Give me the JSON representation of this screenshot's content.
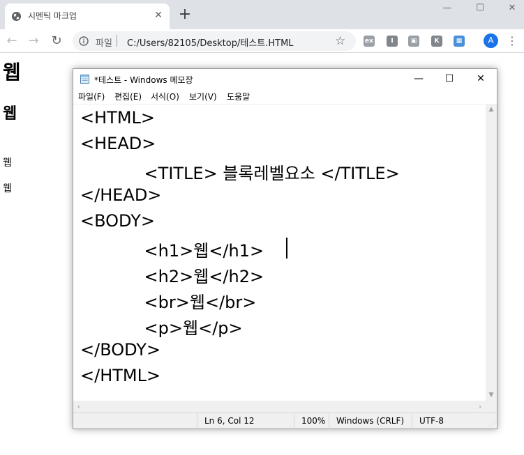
{
  "browser": {
    "tab_title": "시멘틱 마크업",
    "tab_close": "✕",
    "new_tab": "+",
    "window_controls": {
      "minimize": "—",
      "maximize": "☐",
      "close": "✕"
    },
    "nav": {
      "back": "←",
      "forward": "→",
      "reload": "↻"
    },
    "address": {
      "scheme_label": "파일",
      "url": "C:/Users/82105/Desktop/테스트.HTML"
    },
    "extensions": [
      {
        "name": "ext-gray-icon",
        "glyph": "ex",
        "color": "#9aa0a6"
      },
      {
        "name": "ext-i-icon",
        "glyph": "I",
        "color": "#80868b"
      },
      {
        "name": "ext-screen-icon",
        "glyph": "▣",
        "color": "#9aa0a6"
      },
      {
        "name": "ext-k-icon",
        "glyph": "K",
        "color": "#80868b"
      },
      {
        "name": "ext-photo-icon",
        "glyph": "▦",
        "color": "#4a90d9"
      }
    ],
    "profile_initial": "A",
    "menu_glyph": "⋮"
  },
  "page": {
    "h1": "웹",
    "h2": "웹",
    "br_text": "웹",
    "p_text": "웹"
  },
  "notepad": {
    "title": "*테스트 - Windows 메모장",
    "controls": {
      "minimize": "—",
      "maximize": "☐",
      "close": "✕"
    },
    "menu": [
      "파일(F)",
      "편집(E)",
      "서식(O)",
      "보기(V)",
      "도움말"
    ],
    "lines": [
      "<HTML>",
      "<HEAD>",
      "            <TITLE> 블록레벨요소 </TITLE>",
      "</HEAD>",
      "<BODY>",
      "            <h1>웹</h1>",
      "            <h2>웹</h2>",
      "            <br>웹</br>",
      "            <p>웹</p>",
      "</BODY>",
      "</HTML>"
    ],
    "status": {
      "position": "Ln 6, Col 12",
      "zoom": "100%",
      "line_ending": "Windows (CRLF)",
      "encoding": "UTF-8"
    }
  },
  "colors": {
    "tabbar": "#dee1e6",
    "omnibox": "#f1f3f4",
    "accent": "#1a73e8"
  }
}
